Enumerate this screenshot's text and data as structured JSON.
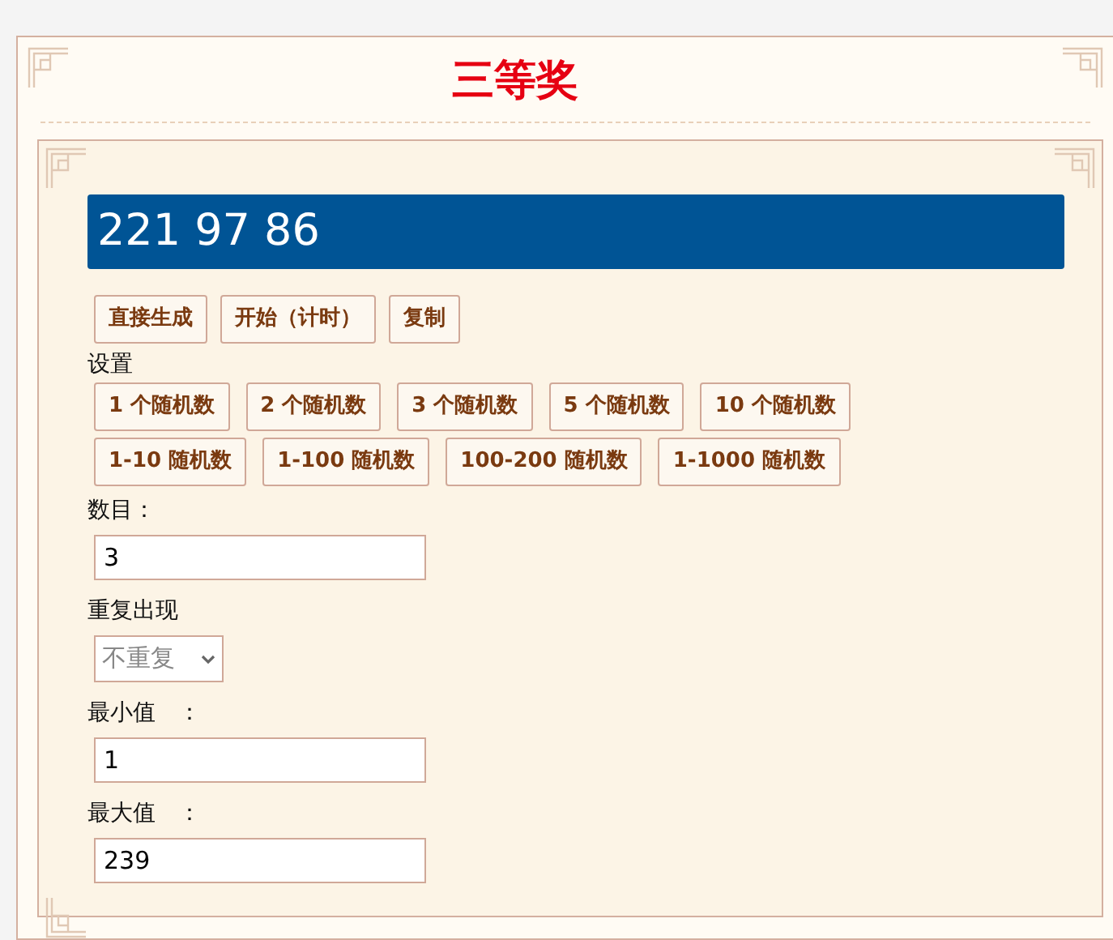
{
  "title": "三等奖",
  "result": "221 97 86",
  "actions": [
    "直接生成",
    "开始（计时）",
    "复制"
  ],
  "settings_label": "设置",
  "preset_rows": [
    [
      "1 个随机数",
      "2 个随机数",
      "3 个随机数",
      "5 个随机数",
      "10 个随机数"
    ],
    [
      "1-10 随机数",
      "1-100 随机数",
      "100-200 随机数",
      "1-1000 随机数"
    ]
  ],
  "fields": [
    {
      "kind": "text",
      "label": "数目：",
      "value": "3"
    },
    {
      "kind": "select",
      "label": "重复出现",
      "value": "不重复"
    },
    {
      "kind": "text",
      "label": "最小值　：",
      "value": "1"
    },
    {
      "kind": "text",
      "label": "最大值　：",
      "value": "239"
    }
  ]
}
